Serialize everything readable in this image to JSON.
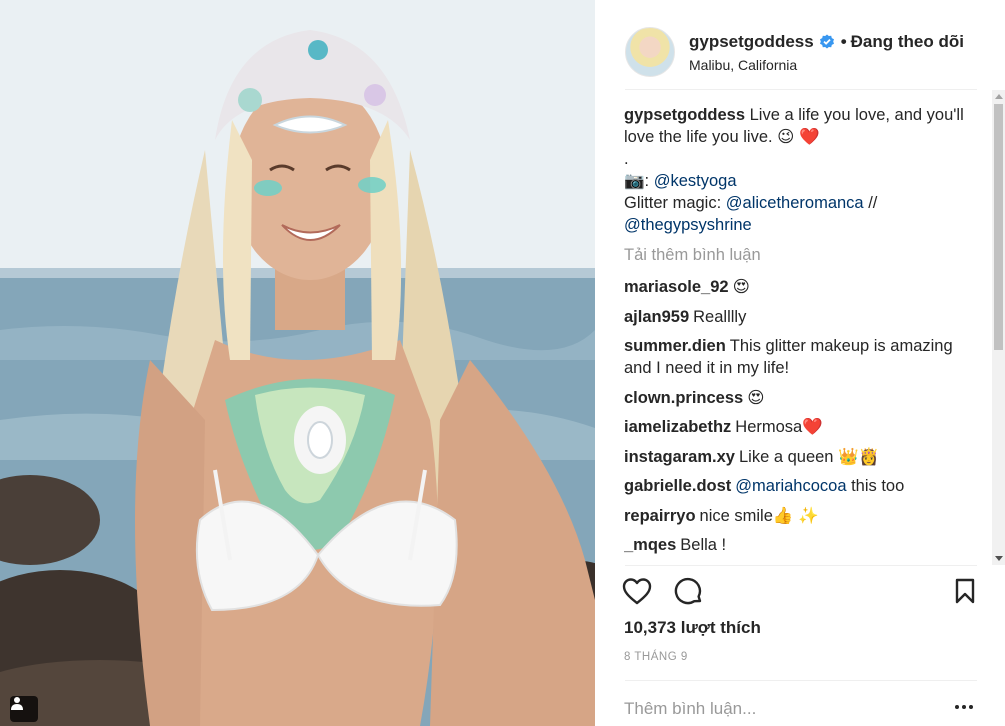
{
  "post": {
    "username": "gypsetgoddess",
    "separator": "•",
    "follow_status": "Đang theo dõi",
    "location": "Malibu, California"
  },
  "caption": {
    "username": "gypsetgoddess",
    "line1": "Live a life you love, and you'll love the life you live. 😉 ❤️",
    "dot": ".",
    "photo_credit_prefix": "📷: ",
    "photo_credit_handle": "@kestyoga",
    "glitter_prefix": "Glitter magic: ",
    "glitter_handle1": "@alicetheromanca",
    "glitter_separator": " // ",
    "glitter_handle2": "@thegypsyshrine"
  },
  "load_more": "Tải thêm bình luận",
  "comments": [
    {
      "user": "mariasole_92",
      "text": "😍"
    },
    {
      "user": "ajlan959",
      "text": "Realllly"
    },
    {
      "user": "summer.dien",
      "text": "This glitter makeup is amazing and I need it in my life!"
    },
    {
      "user": "clown.princess",
      "text": "😍"
    },
    {
      "user": "iamelizabethz",
      "text": "Hermosa❤️"
    },
    {
      "user": "instagaram.xy",
      "text": "Like a queen 👑👸"
    },
    {
      "user": "gabrielle.dost",
      "mention": "@mariahcocoa",
      "text": " this too"
    },
    {
      "user": "repairryo",
      "text": "nice smile👍 ✨"
    },
    {
      "user": "_mqes",
      "text": "Bella !"
    }
  ],
  "stats": {
    "likes": "10,373 lượt thích",
    "date": "8 THÁNG 9"
  },
  "add_comment": {
    "placeholder": "Thêm bình luận..."
  },
  "icons": {
    "verified": "verified-badge-icon",
    "like": "heart-outline-icon",
    "comment": "speech-bubble-icon",
    "save": "bookmark-icon",
    "more": "more-options-icon",
    "tag": "person-tag-icon"
  },
  "colors": {
    "text": "#262626",
    "muted": "#999999",
    "link": "#003569",
    "verified": "#3897f0",
    "divider": "#efefef"
  }
}
